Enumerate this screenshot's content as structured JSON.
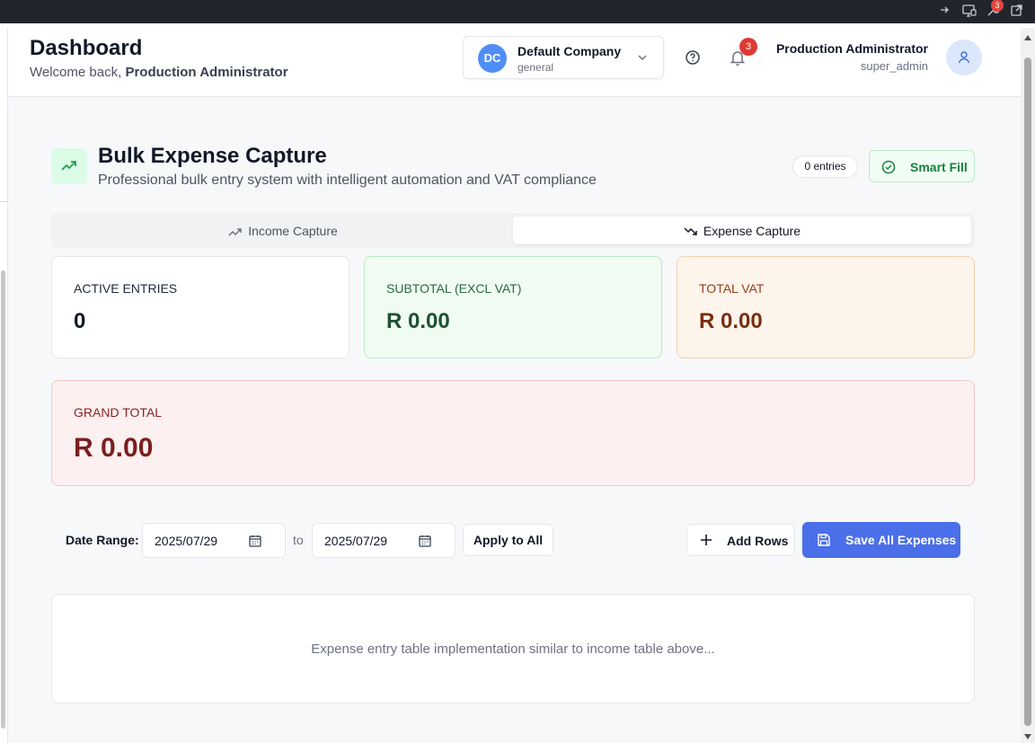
{
  "header": {
    "title": "Dashboard",
    "welcome_prefix": "Welcome back,",
    "welcome_name": "Production Administrator",
    "company": {
      "initials": "DC",
      "name": "Default Company",
      "type": "general"
    },
    "notifications_count": "3",
    "user": {
      "name": "Production Administrator",
      "role": "super_admin"
    }
  },
  "browser": {
    "extension_badge": "3"
  },
  "section": {
    "title": "Bulk Expense Capture",
    "subtitle": "Professional bulk entry system with intelligent automation and VAT compliance",
    "entries_badge": "0 entries",
    "smart_fill_label": "Smart Fill"
  },
  "tabs": [
    {
      "label": "Income Capture",
      "active": false
    },
    {
      "label": "Expense Capture",
      "active": true
    }
  ],
  "stats": {
    "active_entries": {
      "label": "ACTIVE ENTRIES",
      "value": "0"
    },
    "subtotal": {
      "label": "SUBTOTAL (EXCL VAT)",
      "value": "R 0.00"
    },
    "total_vat": {
      "label": "TOTAL VAT",
      "value": "R 0.00"
    },
    "grand_total": {
      "label": "GRAND TOTAL",
      "value": "R 0.00"
    }
  },
  "controls": {
    "date_range_label": "Date Range:",
    "date_from": "2025/07/29",
    "to_label": "to",
    "date_to": "2025/07/29",
    "apply_label": "Apply to All",
    "add_rows_label": "Add Rows",
    "save_label": "Save All Expenses"
  },
  "table": {
    "placeholder": "Expense entry table implementation similar to income table above..."
  },
  "colors": {
    "accent": "#4b6fe8",
    "success": "#16803c",
    "danger": "#dc3b35"
  }
}
